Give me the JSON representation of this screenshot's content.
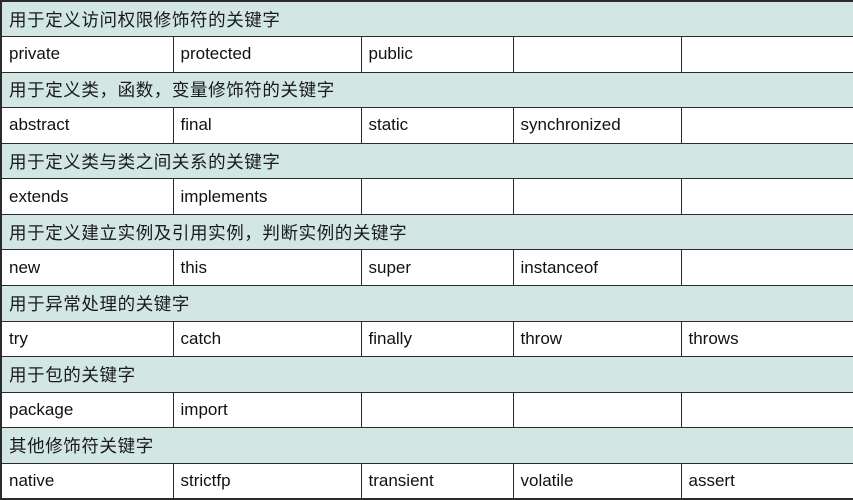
{
  "table": {
    "column_count": 5,
    "colors": {
      "header_band_background": "#d2e6e4",
      "row_background": "#ffffff",
      "border": "#2b2b2b",
      "text": "#111111"
    },
    "sections": [
      {
        "header": "用于定义访问权限修饰符的关键字",
        "keywords": [
          "private",
          "protected",
          "public",
          "",
          ""
        ]
      },
      {
        "header": "用于定义类，函数，变量修饰符的关键字",
        "keywords": [
          "abstract",
          "final",
          "static",
          "synchronized",
          ""
        ]
      },
      {
        "header": "用于定义类与类之间关系的关键字",
        "keywords": [
          "extends",
          "implements",
          "",
          "",
          ""
        ]
      },
      {
        "header": "用于定义建立实例及引用实例，判断实例的关键字",
        "keywords": [
          "new",
          "this",
          "super",
          "instanceof",
          ""
        ]
      },
      {
        "header": "用于异常处理的关键字",
        "keywords": [
          "try",
          "catch",
          "finally",
          "throw",
          "throws"
        ]
      },
      {
        "header": "用于包的关键字",
        "keywords": [
          "package",
          "import",
          "",
          "",
          ""
        ]
      },
      {
        "header": "其他修饰符关键字",
        "keywords": [
          "native",
          "strictfp",
          "transient",
          "volatile",
          "assert"
        ]
      }
    ]
  }
}
